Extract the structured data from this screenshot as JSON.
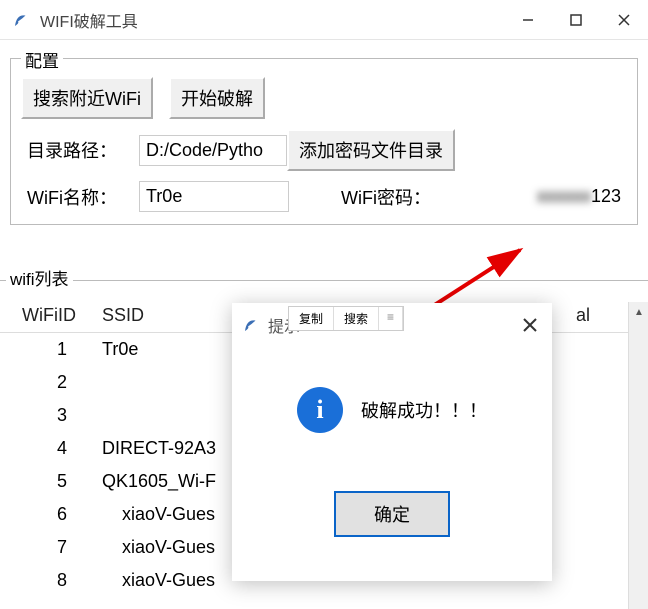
{
  "window": {
    "title": "WIFI破解工具"
  },
  "config": {
    "legend": "配置",
    "btn_search": "搜索附近WiFi",
    "btn_crack": "开始破解",
    "path_label": "目录路径：",
    "path_value": "D:/Code/Pytho",
    "btn_add_dict": "添加密码文件目录",
    "wifi_name_label": "WiFi名称：",
    "wifi_name_value": "Tr0e",
    "wifi_pwd_label": "WiFi密码：",
    "wifi_pwd_hidden": "xxxxxx",
    "wifi_pwd_tail": "123"
  },
  "list": {
    "legend": "wifi列表",
    "headers": {
      "id": "WiFiID",
      "ssid": "SSID",
      "signal": "al"
    },
    "rows": [
      {
        "id": "1",
        "ssid": "Tr0e"
      },
      {
        "id": "2",
        "ssid": ""
      },
      {
        "id": "3",
        "ssid": ""
      },
      {
        "id": "4",
        "ssid": "DIRECT-92A3"
      },
      {
        "id": "5",
        "ssid": "QK1605_Wi-F"
      },
      {
        "id": "6",
        "ssid": "xiaoV-Gues"
      },
      {
        "id": "7",
        "ssid": "xiaoV-Gues"
      },
      {
        "id": "8",
        "ssid": "xiaoV-Gues"
      }
    ]
  },
  "context_toolbar": {
    "copy": "复制",
    "search": "搜索",
    "more": "≡"
  },
  "dialog": {
    "title": "提示",
    "message": "破解成功！！！",
    "ok": "确定"
  }
}
